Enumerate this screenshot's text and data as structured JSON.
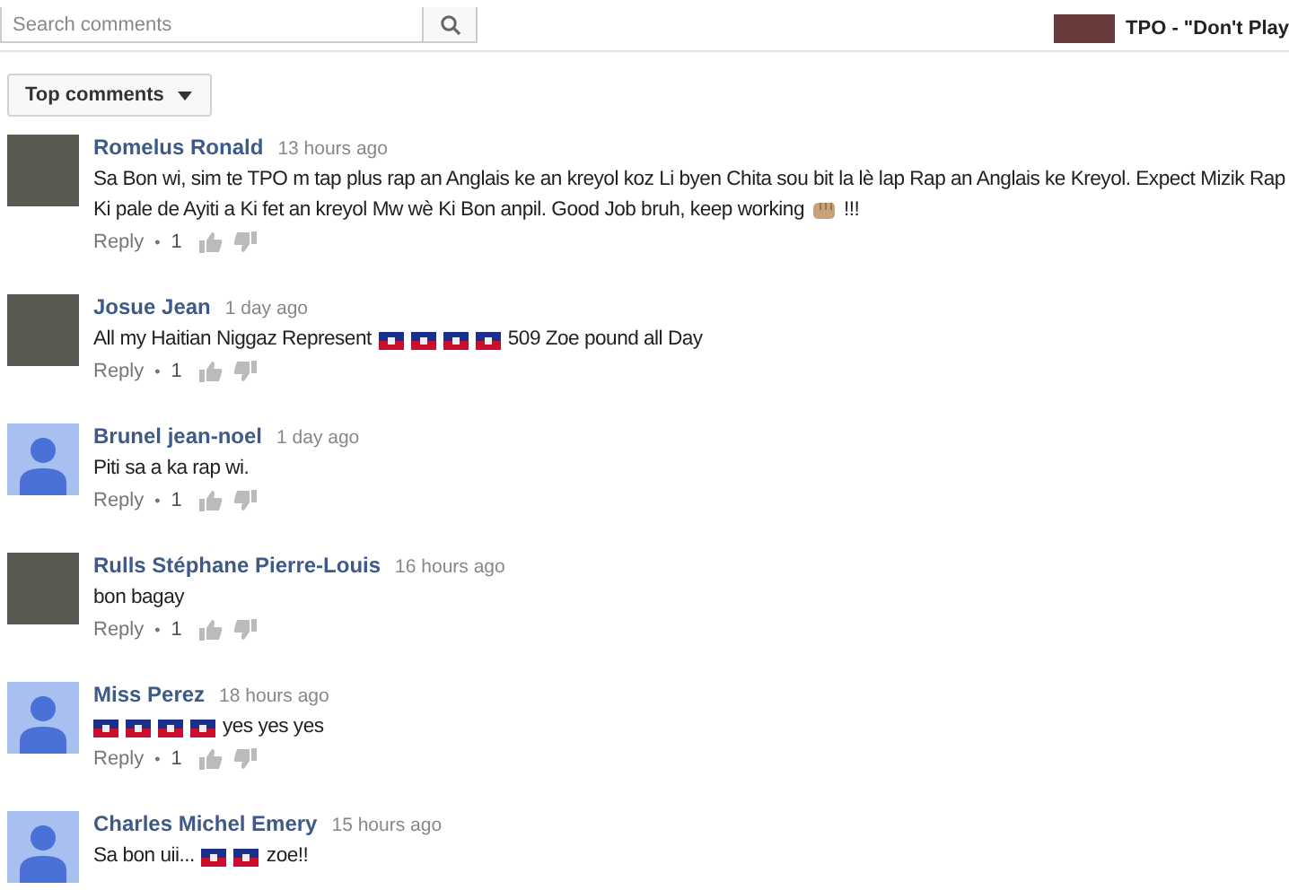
{
  "search": {
    "placeholder": "Search comments"
  },
  "video": {
    "title": "TPO - \"Don't Play"
  },
  "sort": {
    "label": "Top comments"
  },
  "comments": [
    {
      "author": "Romelus Ronald",
      "time": "13 hours ago",
      "kind": "photo",
      "body": [
        {
          "kind": "text",
          "text": "Sa Bon wi, sim te TPO m tap plus rap an Anglais ke an kreyol koz Li byen Chita sou bit la lè lap Rap an Anglais ke Kreyol. Expect Mizik Rap"
        },
        {
          "kind": "text",
          "text": "Ki pale de Ayiti a Ki fet an kreyol Mw wè Ki Bon anpil. Good Job bruh, keep working"
        },
        {
          "kind": "fist"
        },
        {
          "kind": "text",
          "text": "!!!"
        }
      ],
      "reply": "Reply",
      "separator": "•",
      "likes": "1"
    },
    {
      "author": "Josue Jean",
      "time": "1 day ago",
      "kind": "photo",
      "body": [
        {
          "kind": "text",
          "text": "All my Haitian Niggaz Represent"
        },
        {
          "kind": "flag"
        },
        {
          "kind": "flag"
        },
        {
          "kind": "flag"
        },
        {
          "kind": "flag"
        },
        {
          "kind": "text",
          "text": "509 Zoe pound all Day"
        }
      ],
      "reply": "Reply",
      "separator": "•",
      "likes": "1"
    },
    {
      "author": "Brunel jean-noel",
      "time": "1 day ago",
      "kind": "default",
      "body": [
        {
          "kind": "text",
          "text": "Piti sa a ka rap wi."
        }
      ],
      "reply": "Reply",
      "separator": "•",
      "likes": "1"
    },
    {
      "author": "Rulls Stéphane Pierre-Louis",
      "time": "16 hours ago",
      "kind": "photo",
      "body": [
        {
          "kind": "text",
          "text": "bon bagay"
        }
      ],
      "reply": "Reply",
      "separator": "•",
      "likes": "1"
    },
    {
      "author": "Miss Perez",
      "time": "18 hours ago",
      "kind": "default",
      "body": [
        {
          "kind": "flag"
        },
        {
          "kind": "flag"
        },
        {
          "kind": "flag"
        },
        {
          "kind": "flag"
        },
        {
          "kind": "text",
          "text": "yes yes yes"
        }
      ],
      "reply": "Reply",
      "separator": "•",
      "likes": "1"
    },
    {
      "author": "Charles Michel Emery",
      "time": "15 hours ago",
      "kind": "default",
      "body": [
        {
          "kind": "text",
          "text": "Sa bon uii..."
        },
        {
          "kind": "flag"
        },
        {
          "kind": "flag"
        },
        {
          "kind": "text",
          "text": "zoe!!"
        }
      ]
    }
  ]
}
